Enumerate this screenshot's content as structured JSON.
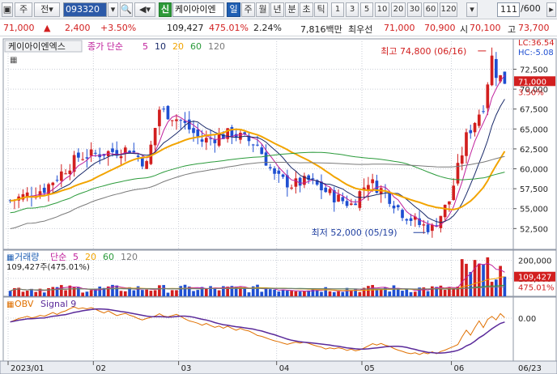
{
  "toolbar": {
    "market_select": "주",
    "before_btn": "전",
    "code": "093320",
    "sin": "신",
    "name": "케이아이엔",
    "periods": [
      "일",
      "주",
      "월",
      "년",
      "분",
      "초",
      "틱"
    ],
    "active_period": 0,
    "intervals": [
      "1",
      "3",
      "5",
      "10",
      "20",
      "30",
      "60",
      "120"
    ],
    "count": "111",
    "total": "/600"
  },
  "quote": {
    "price": "71,000",
    "arrow": "▲",
    "change": "2,400",
    "change_rate": "+3.50%",
    "volume": "109,427",
    "volume_ratio": "475.01%",
    "turnover_rate": "2.24%",
    "trade_amount": "7,816백만",
    "ask_label": "최우선",
    "ask": "71,000",
    "bid": "70,900",
    "open_label": "시",
    "open": "70,100",
    "high_label": "고",
    "high": "73,700"
  },
  "price_panel": {
    "stock_label": "케이아이엔엑스",
    "ma_label": "종가 단순",
    "ma_periods": [
      "5",
      "10",
      "20",
      "60",
      "120"
    ],
    "ma_colors": [
      "#c0209c",
      "#1a2a6a",
      "#f2a400",
      "#2a9a3a",
      "#7a7a7a"
    ],
    "lc": "LC:36.54",
    "hc": "HC:-5.08",
    "price_ticks": [
      "72,500",
      "70,000",
      "67,500",
      "65,000",
      "62,500",
      "60,000",
      "57,500",
      "55,000",
      "52,500"
    ],
    "current_price_tag": "71,000",
    "current_rate_tag": "3.50%",
    "high_annotation": "최고 74,800 (06/16)",
    "low_annotation": "최저 52,000 (05/19)"
  },
  "volume_panel": {
    "label": "거래량",
    "ma_label": "단순",
    "ma_periods": [
      "5",
      "20",
      "60",
      "120"
    ],
    "ma_colors": [
      "#c0209c",
      "#f2a400",
      "#2a9a3a",
      "#7a7a7a"
    ],
    "value_text": "109,427주(475.01%)",
    "ticks": [
      "200,000",
      "100,000"
    ],
    "value_tag": "109,427",
    "rate_tag": "475.01%"
  },
  "obv_panel": {
    "label": "OBV",
    "signal_label": "Signal 9",
    "tick": "0.00"
  },
  "x_axis": {
    "labels": [
      "2023/01",
      "02",
      "03",
      "04",
      "05",
      "06"
    ],
    "end_label": "06/23"
  },
  "colors": {
    "up": "#d21f1f",
    "down": "#1f4fd2",
    "grid": "#c9cdd6"
  }
}
